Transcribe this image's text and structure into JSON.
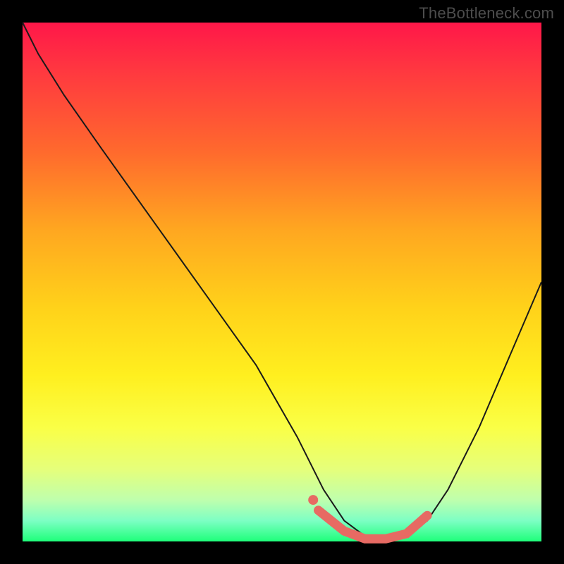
{
  "watermark": "TheBottleneck.com",
  "colors": {
    "frame": "#000000",
    "watermark_text": "#4d4d4d",
    "curve_stroke": "#1a1a1a",
    "marker": "#e76a63",
    "gradient_top": "#ff1749",
    "gradient_bottom": "#1eff7a"
  },
  "chart_data": {
    "type": "line",
    "title": "",
    "xlabel": "",
    "ylabel": "",
    "xlim": [
      0,
      100
    ],
    "ylim": [
      0,
      100
    ],
    "series": [
      {
        "name": "bottleneck-curve",
        "x": [
          0,
          3,
          8,
          15,
          25,
          35,
          45,
          53,
          58,
          62,
          66,
          70,
          74,
          78,
          82,
          88,
          94,
          100
        ],
        "y": [
          100,
          94,
          86,
          76,
          62,
          48,
          34,
          20,
          10,
          4,
          1,
          0,
          1,
          4,
          10,
          22,
          36,
          50
        ]
      }
    ],
    "markers": {
      "name": "optimal-range",
      "x": [
        57,
        62,
        66,
        70,
        74,
        78
      ],
      "y": [
        6,
        2,
        0.5,
        0.5,
        1.5,
        5
      ],
      "lead_dot": {
        "x": 56,
        "y": 8
      }
    },
    "annotations": [],
    "legend": false,
    "grid": false
  }
}
